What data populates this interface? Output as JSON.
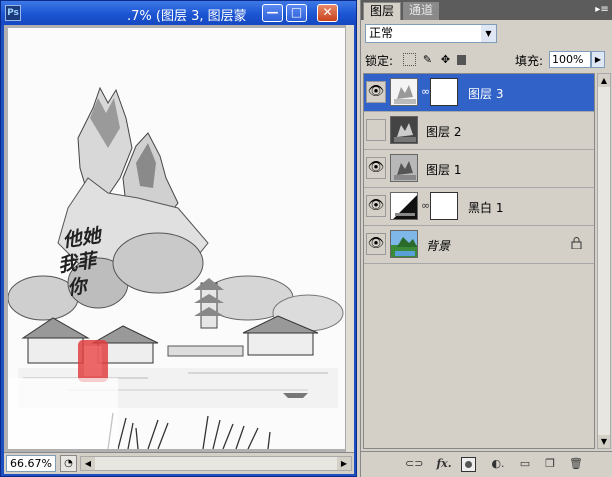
{
  "document": {
    "title": ".7% (图层 3, 图层蒙",
    "zoom": "66.67%",
    "canvas_text_poem_line1": "他她",
    "canvas_text_poem_line2": "我菲",
    "canvas_text_poem_line3": "你"
  },
  "window_controls": {
    "minimize": "—",
    "restore": "□",
    "close": "✕"
  },
  "panel": {
    "tabs": [
      {
        "label": "图层"
      },
      {
        "label": "通道"
      }
    ],
    "blend_mode": "正常",
    "lock_label": "锁定:",
    "fill_label": "填充:",
    "fill_value": "100%",
    "layers": [
      {
        "name": "图层 3",
        "visible": true,
        "selected": true,
        "has_mask": true
      },
      {
        "name": "图层 2",
        "visible": false,
        "selected": false,
        "has_mask": false
      },
      {
        "name": "图层 1",
        "visible": true,
        "selected": false,
        "has_mask": false
      },
      {
        "name": "黑白 1",
        "visible": true,
        "selected": false,
        "has_mask": true
      },
      {
        "name": "背景",
        "visible": true,
        "selected": false,
        "has_mask": false,
        "locked": true
      }
    ],
    "colors": {
      "selected_row": "#3162c8",
      "panel_bg": "#d4d0c8",
      "tab_bar": "#5c5c5c"
    }
  }
}
